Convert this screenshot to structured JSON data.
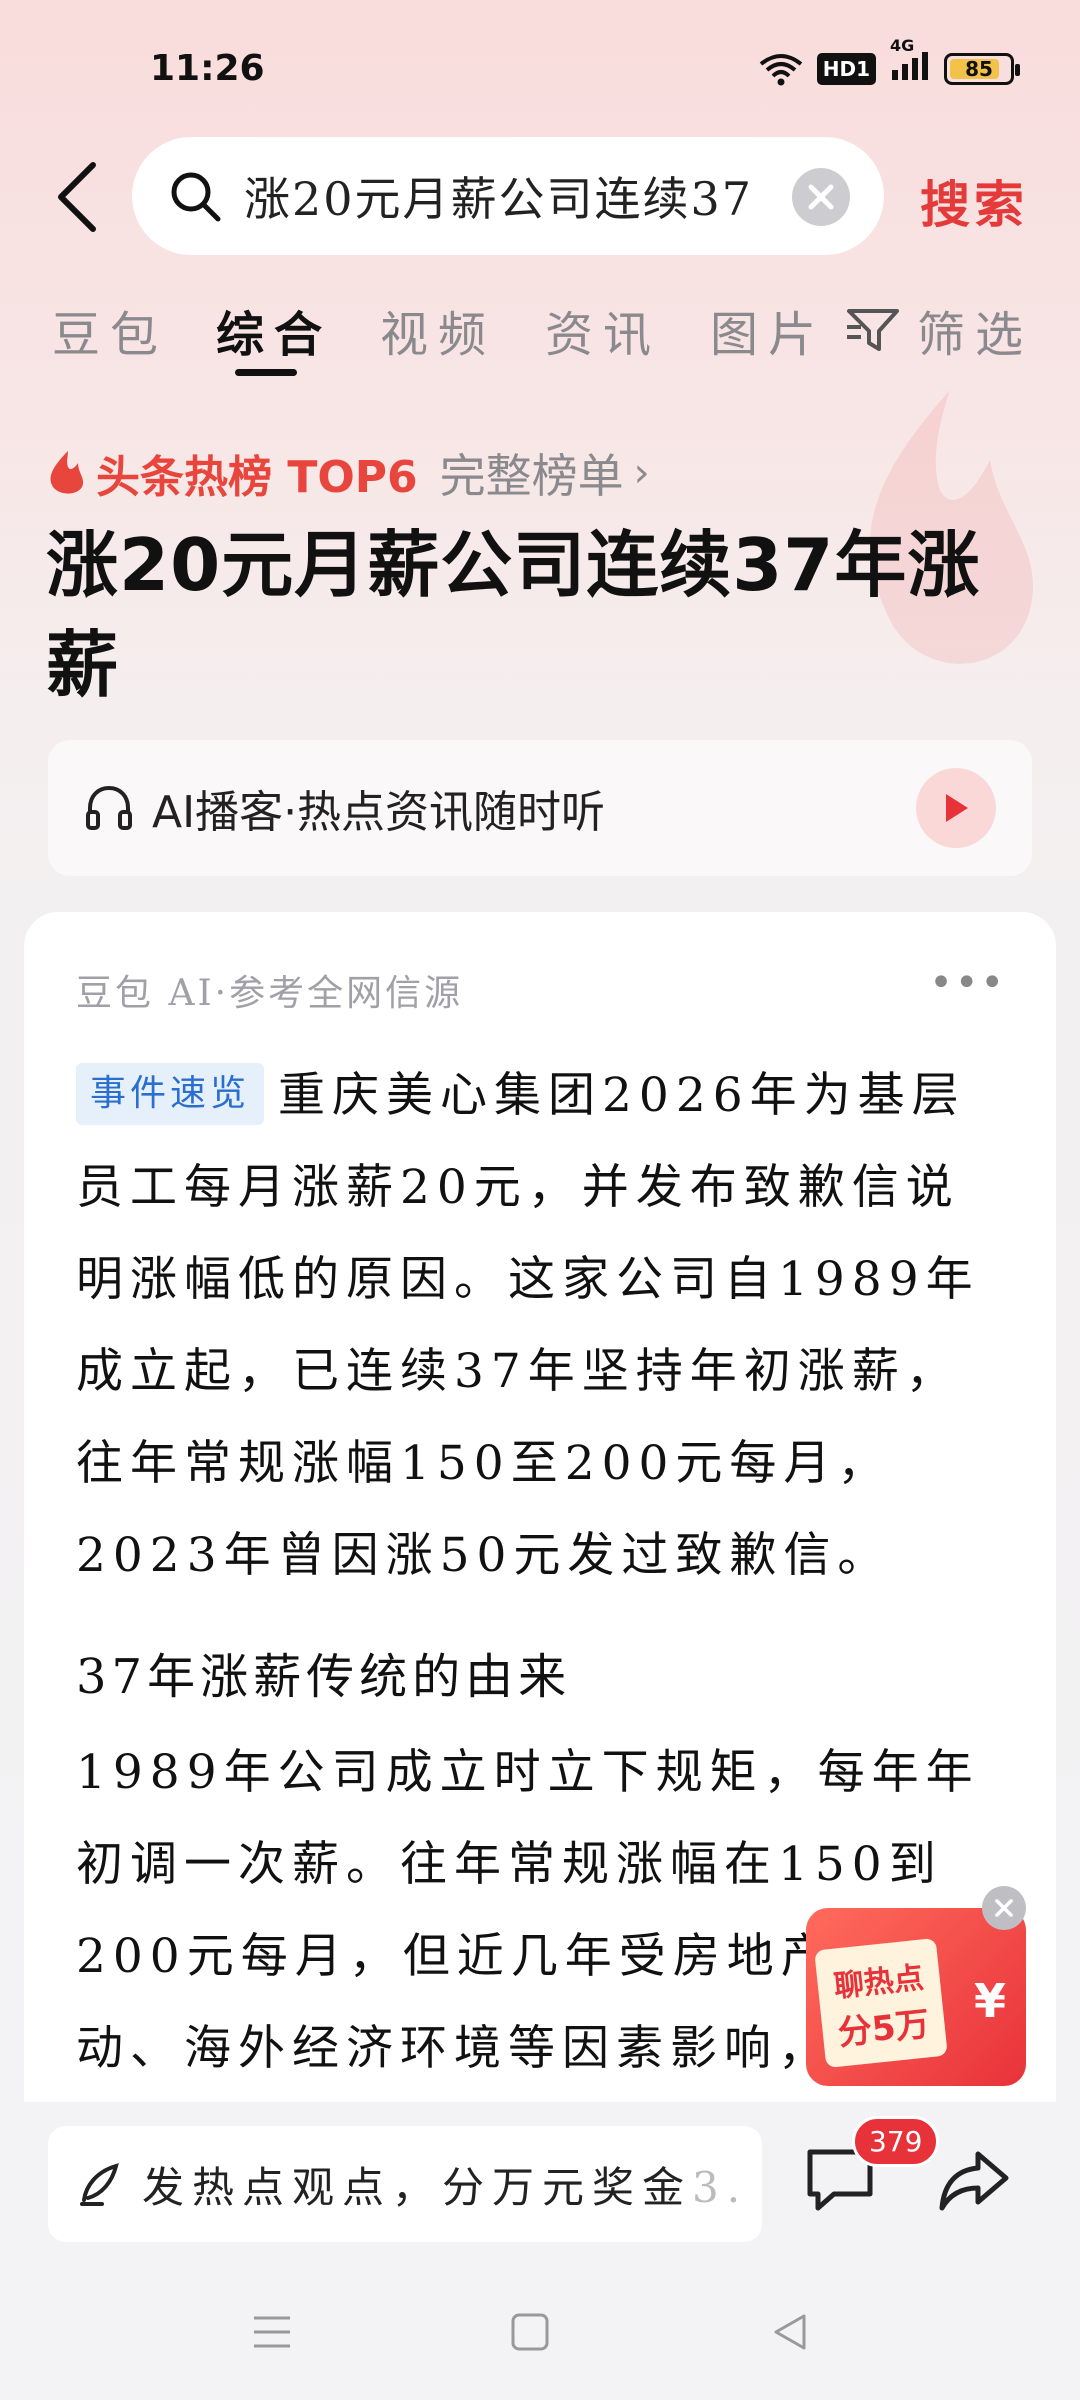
{
  "status_bar": {
    "time": "11:26",
    "hd_label": "HD1",
    "network_label": "4G",
    "battery_level": "85",
    "battery_fraction": 0.85
  },
  "search": {
    "query": "涨20元月薪公司连续37",
    "submit_label": "搜索"
  },
  "tabs": [
    {
      "label": "豆包",
      "active": false
    },
    {
      "label": "综合",
      "active": true
    },
    {
      "label": "视频",
      "active": false
    },
    {
      "label": "资讯",
      "active": false
    },
    {
      "label": "图片",
      "active": false
    },
    {
      "label": "筛选",
      "active": false
    }
  ],
  "hot": {
    "rank_label": "头条热榜 TOP6",
    "full_list_label": "完整榜单"
  },
  "headline": "涨20元月薪公司连续37年涨薪",
  "podcast": {
    "label": "AI播客·热点资讯随时听"
  },
  "card": {
    "source": "豆包 AI·参考全网信源",
    "tag": "事件速览",
    "summary": "重庆美心集团2026年为基层员工每月涨薪20元，并发布致歉信说明涨幅低的原因。这家公司自1989年成立起，已连续37年坚持年初涨薪，往年常规涨幅150至200元每月，2023年曾因涨50元发过致歉信。",
    "section_title": "37年涨薪传统的由来",
    "section_body": "1989年公司成立时立下规矩，每年年初调一次薪。往年常规涨幅在150到200元每月，但近几年受房地产波动、海外经济环境等因素影响，公司"
  },
  "promo": {
    "line1": "聊热点",
    "line2": "分5万",
    "currency": "¥"
  },
  "bottom": {
    "comment_placeholder": "发热点观点，分万元奖金",
    "comment_suffix": "3.",
    "comment_count": "379"
  },
  "colors": {
    "accent_red": "#e53a3a",
    "tag_blue": "#2a6fd0",
    "tag_bg": "#e6f0fb"
  }
}
